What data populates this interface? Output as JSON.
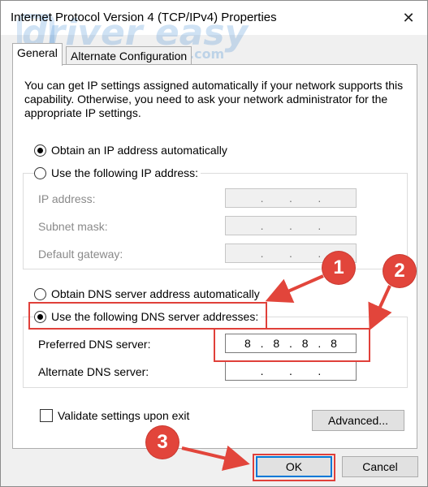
{
  "window": {
    "title": "Internet Protocol Version 4 (TCP/IPv4) Properties",
    "close_glyph": "✕"
  },
  "watermark": {
    "text": "driver easy",
    "sub": ".com"
  },
  "tabs": [
    {
      "label": "General",
      "active": true
    },
    {
      "label": "Alternate Configuration",
      "active": false
    }
  ],
  "intro_text": "You can get IP settings assigned automatically if your network supports this capability. Otherwise, you need to ask your network administrator for the appropriate IP settings.",
  "ip_section": {
    "obtain_auto_label": "Obtain an IP address automatically",
    "obtain_auto_checked": true,
    "use_following_label": "Use the following IP address:",
    "use_following_checked": false,
    "fields": [
      {
        "label": "IP address:",
        "segments": [
          "",
          "",
          "",
          ""
        ],
        "disabled": true
      },
      {
        "label": "Subnet mask:",
        "segments": [
          "",
          "",
          "",
          ""
        ],
        "disabled": true
      },
      {
        "label": "Default gateway:",
        "segments": [
          "",
          "",
          "",
          ""
        ],
        "disabled": true
      }
    ]
  },
  "dns_section": {
    "obtain_auto_label": "Obtain DNS server address automatically",
    "obtain_auto_checked": false,
    "use_following_label": "Use the following DNS server addresses:",
    "use_following_checked": true,
    "fields": [
      {
        "label": "Preferred DNS server:",
        "segments": [
          "8",
          "8",
          "8",
          "8"
        ],
        "disabled": false
      },
      {
        "label": "Alternate DNS server:",
        "segments": [
          "",
          "",
          "",
          ""
        ],
        "disabled": false
      }
    ]
  },
  "validate_label": "Validate settings upon exit",
  "validate_checked": false,
  "buttons": {
    "advanced": "Advanced...",
    "ok": "OK",
    "cancel": "Cancel"
  },
  "annotations": {
    "badge_1": "1",
    "badge_2": "2",
    "badge_3": "3",
    "color": "#e2453b"
  }
}
